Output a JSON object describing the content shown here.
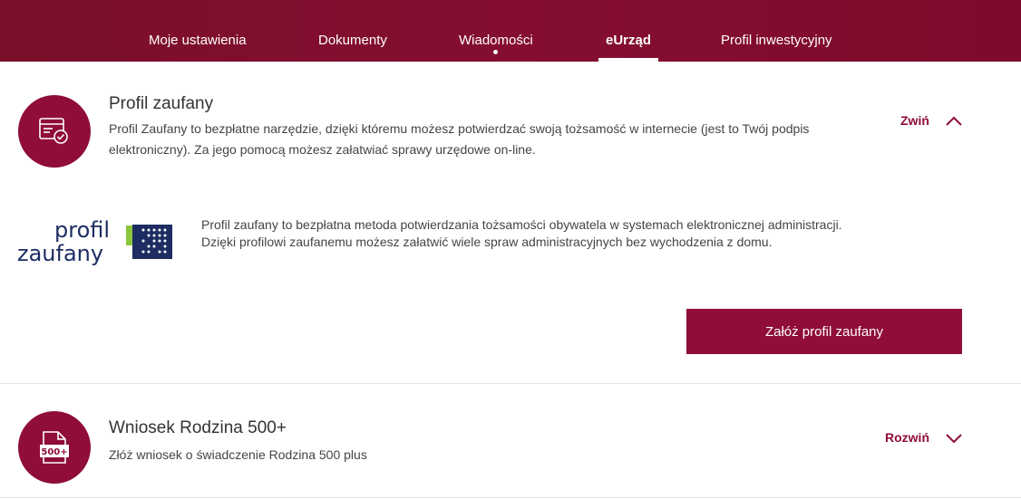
{
  "nav": {
    "items": [
      {
        "label": "Moje ustawienia"
      },
      {
        "label": "Dokumenty"
      },
      {
        "label": "Wiadomości"
      },
      {
        "label": "eUrząd"
      },
      {
        "label": "Profil inwestycyjny"
      }
    ],
    "active": "eUrząd"
  },
  "profil_section": {
    "title": "Profil zaufany",
    "description": "Profil Zaufany to bezpłatne narzędzie, dzięki któremu możesz potwierdzać swoją tożsamość w internecie (jest to Twój podpis elektroniczny). Za jego pomocą możesz załatwiać sprawy urzędowe on-line.",
    "toggle_label": "Zwiń",
    "logo_line1": "profil",
    "logo_line2": "zaufany",
    "details": "Profil zaufany to bezpłatna metoda potwierdzania tożsamości obywatela w systemach elektronicznej administracji. Dzięki profilowi zaufanemu możesz załatwić wiele spraw administracyjnych bez wychodzenia z domu.",
    "cta_label": "Załóż profil zaufany"
  },
  "rodzina_section": {
    "title": "Wniosek Rodzina 500+",
    "description": "Złóż wniosek o świadczenie Rodzina 500 plus",
    "toggle_label": "Rozwiń",
    "icon_text": "500+"
  },
  "colors": {
    "brand": "#8f0d38",
    "nav_bg": "#7e0b2b"
  },
  "icons": {
    "profil": "id-card-check-icon",
    "rodzina": "document-500-icon",
    "collapse": "chevron-up-icon",
    "expand": "chevron-down-icon"
  }
}
